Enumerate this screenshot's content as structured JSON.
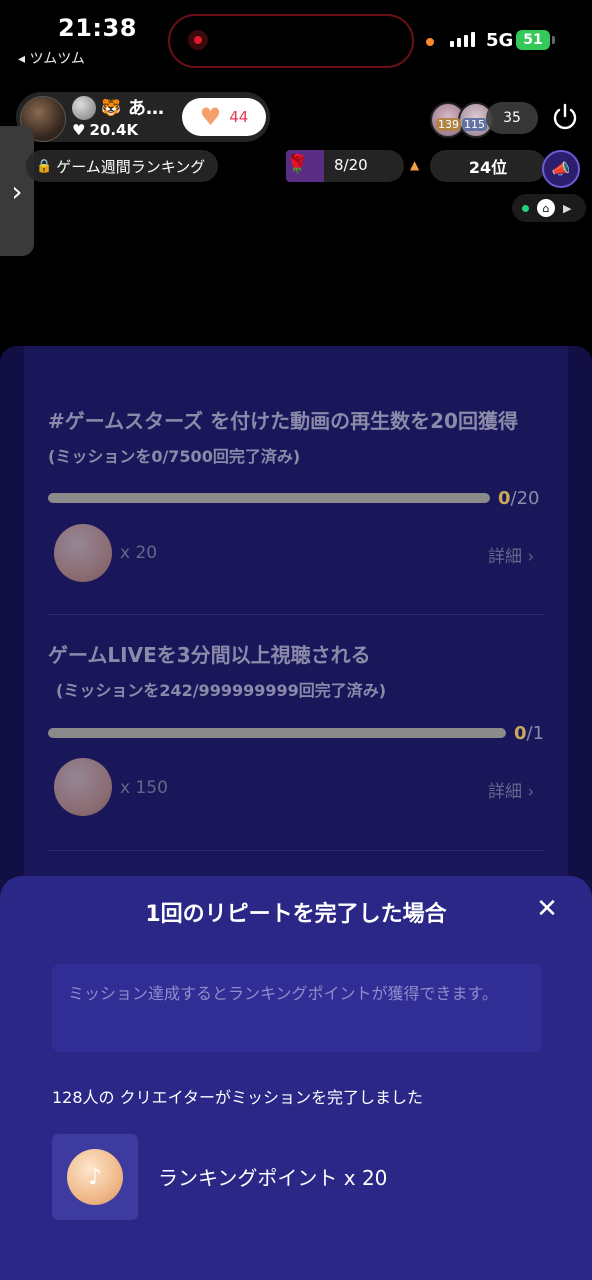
{
  "status_bar": {
    "time": "21:38",
    "back_app": "◂ ツムツム",
    "network": "5G",
    "battery": "51"
  },
  "live_header": {
    "host_name": "あ…",
    "host_likes": "20.4K",
    "heart_count": "44",
    "viewer_badge_1": "139",
    "viewer_badge_2": "115",
    "viewer_count": "35",
    "ranking_label": "ゲーム週間ランキング",
    "progress_text": "8/20",
    "rank_position": "24位"
  },
  "missions": [
    {
      "title": "#ゲームスターズ を付けた動画の再生数を20回獲得",
      "sub": "(ミッションを0/7500回完了済み)",
      "progress_done": "0",
      "progress_total": "/20",
      "reward_mult": "x 20",
      "detail": "詳細 ›"
    },
    {
      "title": "ゲームLIVEを3分間以上視聴される",
      "sub": "(ミッションを242/999999999回完了済み)",
      "progress_done": "0",
      "progress_total": "/1",
      "reward_mult": "x 150",
      "detail": "詳細 ›"
    }
  ],
  "sheet": {
    "title": "1回のリピートを完了した場合",
    "close": "✕",
    "note": "ミッション達成するとランキングポイントが獲得できます。",
    "creators": "128人の クリエイターがミッションを完了しました",
    "reward_label": "ランキングポイント x 20"
  },
  "colors": {
    "sheet_bg": "#2a2787",
    "panel_bg": "#19175a",
    "accent_heart": "#f5a06a",
    "battery_green": "#34c759"
  }
}
